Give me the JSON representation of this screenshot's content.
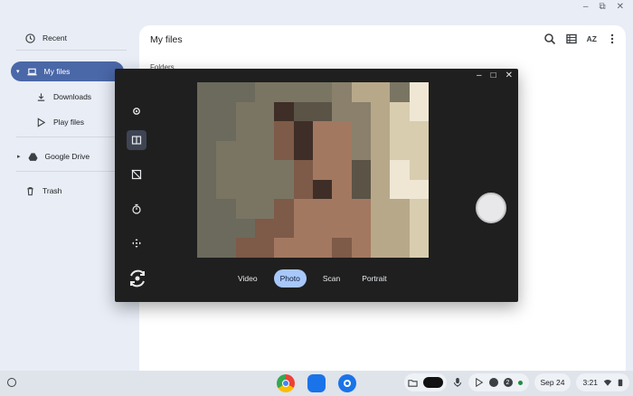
{
  "window": {
    "controls": [
      "–",
      "⧉",
      "✕"
    ]
  },
  "sidebar": {
    "items": [
      {
        "label": "Recent",
        "icon": "clock-icon"
      },
      {
        "label": "My files",
        "icon": "laptop-icon",
        "active": true
      },
      {
        "label": "Downloads",
        "icon": "download-icon"
      },
      {
        "label": "Play files",
        "icon": "play-icon"
      },
      {
        "label": "Google Drive",
        "icon": "drive-icon"
      },
      {
        "label": "Trash",
        "icon": "trash-icon"
      }
    ]
  },
  "main": {
    "title": "My files",
    "section": "Folders",
    "toolbar": {
      "sort_label": "AZ"
    }
  },
  "camera": {
    "modes": [
      "Video",
      "Photo",
      "Scan",
      "Portrait"
    ],
    "active_mode": "Photo",
    "title_controls": [
      "–",
      "□",
      "✕"
    ]
  },
  "shelf": {
    "date": "Sep 24",
    "time": "3:21",
    "notification_count": "2"
  },
  "colors": {
    "accent": "#4a67a8",
    "mode_highlight": "#a8c7fa",
    "camera_bg": "#1f1f1f"
  }
}
